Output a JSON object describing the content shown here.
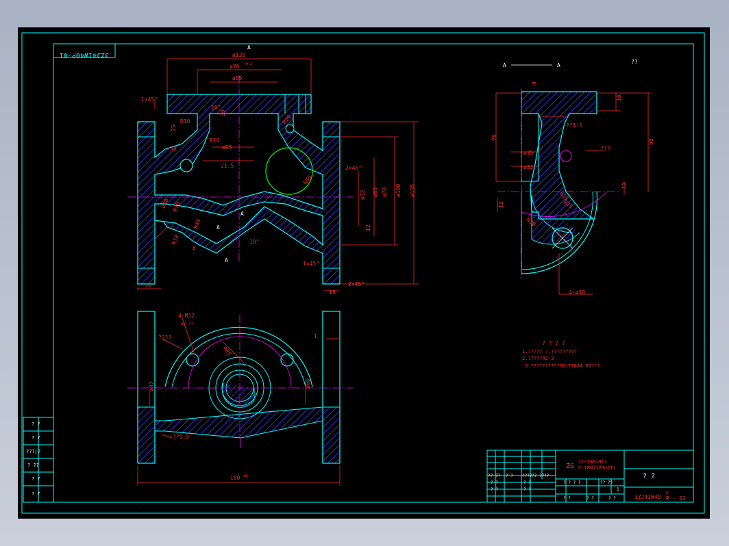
{
  "colors": {
    "background_window": "#a9b3c3",
    "drawing_bg": "#000000",
    "outline": "#00ffff",
    "dimension": "#ff2a2a",
    "hatch": "#3a3aff",
    "centerline": "#ff00ff",
    "highlight": "#00ff00",
    "text_white": "#ffffff",
    "title_block": "#00ffff"
  },
  "drawing_number_stamp": "3ZJ41W40P-01",
  "title_block": {
    "material": "ZG",
    "material_line1": "1Cr18Ni9Ti",
    "material_line2": "Cr18Ni12Mo2Ti",
    "name": "? ?",
    "drawing_number": "3ZJ41W40",
    "drawing_suffix_top": "P",
    "drawing_suffix": "R - 01",
    "header_cells": [
      "?? ??",
      "? ?",
      "????",
      "?? ??",
      "??"
    ],
    "row_labels": [
      "? ?",
      "? ?",
      "? ?",
      "? ?"
    ],
    "scale_cells": [
      "? ? ? ?",
      "?? ??",
      "1"
    ],
    "bottom_cells": [
      "? ?",
      "? ?",
      "? ?"
    ]
  },
  "left_strip": {
    "labels": [
      "? ?",
      "? ?",
      "???|?",
      "? ??",
      "? ?",
      "? ?"
    ]
  },
  "section_labels": {
    "front_A_top": "A",
    "front_A_mid1": "A",
    "front_A_mid2": "A",
    "front_A_bottom": "A",
    "side_view_title_left": "A",
    "side_view_title_right": "A",
    "roughness_note": "??"
  },
  "front_view_dims": {
    "d120": "ø120",
    "d70": "ø70",
    "d70_tol": "+0.2",
    "d55": "ø55",
    "chamfer_top": "1×45°",
    "r10": "R10",
    "v25": "25",
    "v30": "30",
    "v30b": "30",
    "v10": "10°",
    "r10b": "R10",
    "d65": "ø65",
    "v21_5": "21.5",
    "r20": "R20",
    "r45": "R45",
    "v2x45": "2×45°",
    "d32": "ø32",
    "d66": "ø66",
    "d78": "ø78",
    "d100": "ø100",
    "d135": "ø135",
    "r38": "R38",
    "r70": "R70",
    "r40": "R40",
    "r10c": "R10",
    "v8": "8",
    "v10b": "10°",
    "v12": "12",
    "v20": "20",
    "v18": "18",
    "v2x45b": "2×45°",
    "v1x45b": "1×45°"
  },
  "side_view_dims": {
    "d76": "76",
    "v4": "4",
    "v16": "16",
    "v90": "90",
    "v12": "12",
    "v12b": "12",
    "d35": "ø35",
    "d32": "ø32",
    "r13": "R13",
    "r15": "R15",
    "r30": "R30",
    "bolts": "4-ø18",
    "angle_note": "??1:5",
    "radius_note": "???"
  },
  "bottom_view_dims": {
    "thread": "4-M12",
    "thread_depth": "ø3  ??",
    "v1": "1",
    "d82": "ø82",
    "d68": "ø68",
    "d85": "ø85",
    "pitch": "??1:5",
    "length": "180",
    "length_tol": "±1",
    "note_label": "????"
  },
  "tech_requirements": {
    "title": "? ? ? ?",
    "lines": [
      "1.????? ?,?????????",
      "2.?????R2-3",
      "3.??????????GB/T1804-92???"
    ]
  }
}
